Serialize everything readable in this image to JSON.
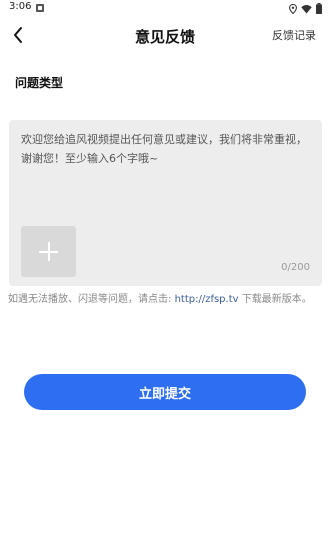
{
  "status_bar": {
    "time": "3:06"
  },
  "header": {
    "title": "意见反馈",
    "history_link": "反馈记录"
  },
  "section": {
    "label": "问题类型"
  },
  "feedback": {
    "placeholder": "欢迎您给追风视频提出任何意见或建议，我们将非常重视，谢谢您！至少输入6个字哦~",
    "value": "",
    "counter": "0/200"
  },
  "note": {
    "text_before": "如遇无法播放、闪退等问题，请点击: ",
    "link": "http://zfsp.tv",
    "text_after": " 下载最新版本。"
  },
  "submit": {
    "label": "立即提交"
  },
  "colors": {
    "accent": "#2e6ff2",
    "box_bg": "#ededed",
    "link": "#3a5f9e"
  },
  "icons": [
    "back-arrow-icon",
    "plus-icon",
    "location-icon",
    "wifi-icon",
    "battery-icon"
  ]
}
